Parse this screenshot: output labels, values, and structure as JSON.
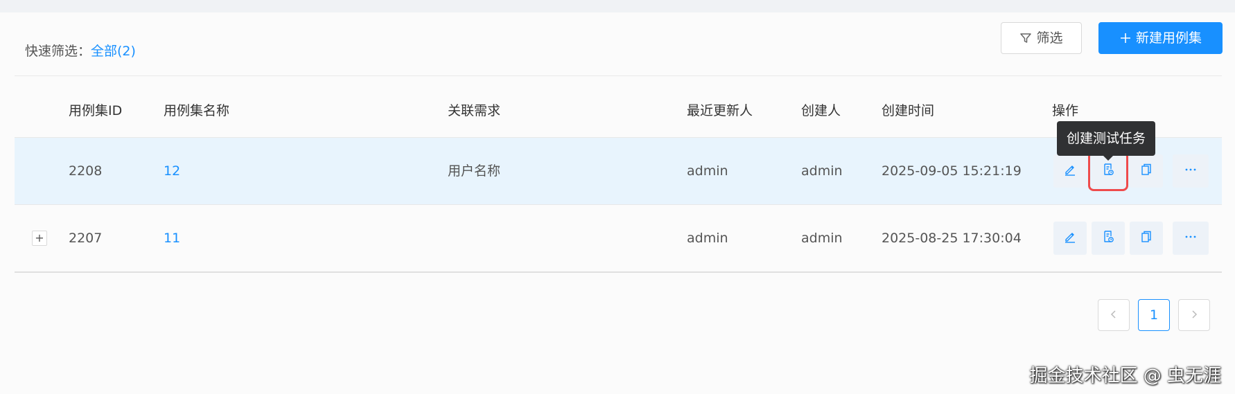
{
  "filter": {
    "label": "快速筛选：",
    "all_link": "全部(2)"
  },
  "toolbar": {
    "filter_label": "筛选",
    "new_label": "新建用例集",
    "accent": "#1890ff"
  },
  "table": {
    "headers": {
      "id": "用例集ID",
      "name": "用例集名称",
      "requirement": "关联需求",
      "updater": "最近更新人",
      "creator": "创建人",
      "created_at": "创建时间",
      "actions": "操作"
    },
    "rows": [
      {
        "id": "2208",
        "name": "12",
        "requirement": "用户名称",
        "updater": "admin",
        "creator": "admin",
        "created_at": "2025-09-05 15:21:19"
      },
      {
        "expand": "+",
        "id": "2207",
        "name": "11",
        "requirement": "",
        "updater": "admin",
        "creator": "admin",
        "created_at": "2025-08-25 17:30:04"
      }
    ]
  },
  "tooltip": {
    "text": "创建测试任务"
  },
  "icons": {
    "edit": "edit-icon",
    "create_task": "create-task-icon",
    "copy": "copy-icon",
    "more": "more-icon"
  },
  "pagination": {
    "current_page": "1"
  },
  "watermark": {
    "text": "掘金技术社区 @ 虫无涯"
  }
}
